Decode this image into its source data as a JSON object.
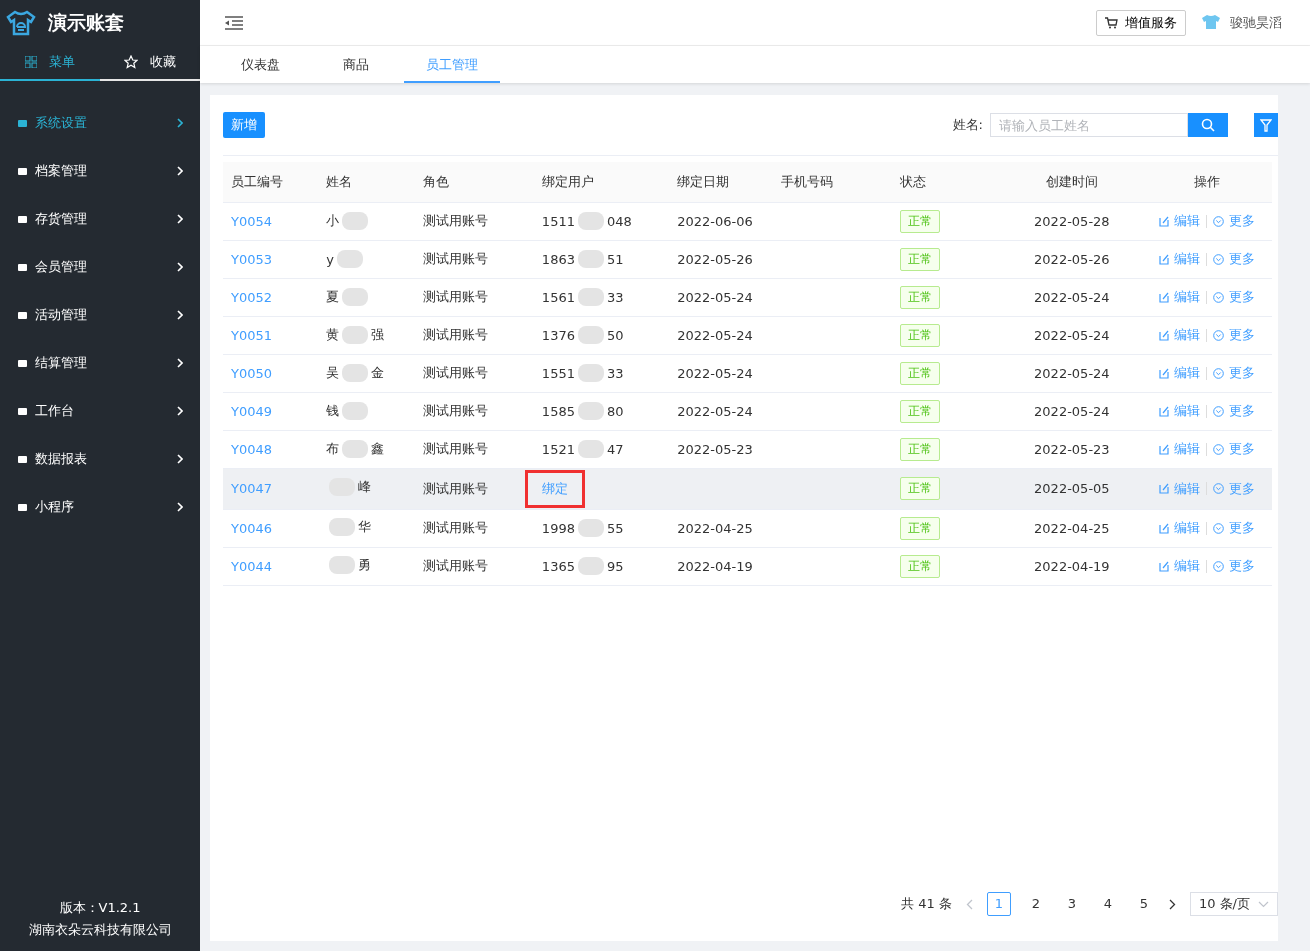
{
  "app": {
    "title": "演示账套",
    "version": "版本：V1.2.1",
    "company": "湖南衣朵云科技有限公司"
  },
  "sidebar_tabs": [
    {
      "label": "菜单",
      "selected": true
    },
    {
      "label": "收藏",
      "selected": false
    }
  ],
  "menu": [
    {
      "label": "系统设置",
      "selected": true
    },
    {
      "label": "档案管理",
      "selected": false
    },
    {
      "label": "存货管理",
      "selected": false
    },
    {
      "label": "会员管理",
      "selected": false
    },
    {
      "label": "活动管理",
      "selected": false
    },
    {
      "label": "结算管理",
      "selected": false
    },
    {
      "label": "工作台",
      "selected": false
    },
    {
      "label": "数据报表",
      "selected": false
    },
    {
      "label": "小程序",
      "selected": false
    }
  ],
  "header": {
    "service_button": "增值服务",
    "user": "骏驰昊滔"
  },
  "tabs": [
    {
      "label": "仪表盘",
      "selected": false
    },
    {
      "label": "商品",
      "selected": false
    },
    {
      "label": "员工管理",
      "selected": true
    }
  ],
  "toolbar": {
    "add_button": "新增",
    "search_label": "姓名:",
    "search": {
      "placeholder": "请输入员工姓名"
    }
  },
  "table": {
    "columns": [
      "员工编号",
      "姓名",
      "角色",
      "绑定用户",
      "绑定日期",
      "手机号码",
      "状态",
      "创建时间",
      "操作"
    ],
    "rows": [
      {
        "id": "Y0054",
        "name_start": "小",
        "role": "测试用账号",
        "user_start": "1511",
        "user_end": "048",
        "bind_date": "2022-06-06",
        "status": "正常",
        "created": "2022-05-28",
        "edit": "编辑",
        "more": "更多",
        "hovered": false
      },
      {
        "id": "Y0053",
        "name_start": "y",
        "role": "测试用账号",
        "user_start": "1863",
        "user_end": "51",
        "bind_date": "2022-05-26",
        "status": "正常",
        "created": "2022-05-26",
        "edit": "编辑",
        "more": "更多",
        "hovered": false
      },
      {
        "id": "Y0052",
        "name_start": "夏",
        "role": "测试用账号",
        "user_start": "1561",
        "user_end": "33",
        "bind_date": "2022-05-24",
        "status": "正常",
        "created": "2022-05-24",
        "edit": "编辑",
        "more": "更多",
        "hovered": false
      },
      {
        "id": "Y0051",
        "name_start": "黄",
        "name_end": "强",
        "role": "测试用账号",
        "user_start": "1376",
        "user_end": "50",
        "bind_date": "2022-05-24",
        "status": "正常",
        "created": "2022-05-24",
        "edit": "编辑",
        "more": "更多",
        "hovered": false
      },
      {
        "id": "Y0050",
        "name_start": "吴",
        "name_end": "金",
        "role": "测试用账号",
        "user_start": "1551",
        "user_end": "33",
        "bind_date": "2022-05-24",
        "status": "正常",
        "created": "2022-05-24",
        "edit": "编辑",
        "more": "更多",
        "hovered": false
      },
      {
        "id": "Y0049",
        "name_start": "钱",
        "role": "测试用账号",
        "user_start": "1585",
        "user_end": "80",
        "bind_date": "2022-05-24",
        "status": "正常",
        "created": "2022-05-24",
        "edit": "编辑",
        "more": "更多",
        "hovered": false
      },
      {
        "id": "Y0048",
        "name_start": "布",
        "name_end": "鑫",
        "role": "测试用账号",
        "user_start": "1521",
        "user_end": "47",
        "bind_date": "2022-05-23",
        "status": "正常",
        "created": "2022-05-23",
        "edit": "编辑",
        "more": "更多",
        "hovered": false
      },
      {
        "id": "Y0047",
        "name_end": "峰",
        "role": "测试用账号",
        "bind_link": "绑定",
        "highlighted": true,
        "status": "正常",
        "created": "2022-05-05",
        "edit": "编辑",
        "more": "更多",
        "hovered": true
      },
      {
        "id": "Y0046",
        "name_end": "华",
        "role": "测试用账号",
        "user_start": "1998",
        "user_end": "55",
        "bind_date": "2022-04-25",
        "status": "正常",
        "created": "2022-04-25",
        "edit": "编辑",
        "more": "更多",
        "hovered": false
      },
      {
        "id": "Y0044",
        "name_end": "勇",
        "role": "测试用账号",
        "user_start": "1365",
        "user_end": "95",
        "bind_date": "2022-04-19",
        "status": "正常",
        "created": "2022-04-19",
        "edit": "编辑",
        "more": "更多",
        "hovered": false
      }
    ]
  },
  "pagination": {
    "total": "共 41 条",
    "pages": [
      {
        "label": "1",
        "selected": true
      },
      {
        "label": "2",
        "selected": false
      },
      {
        "label": "3",
        "selected": false
      },
      {
        "label": "4",
        "selected": false
      },
      {
        "label": "5",
        "selected": false
      }
    ],
    "page_size": "10 条/页"
  }
}
